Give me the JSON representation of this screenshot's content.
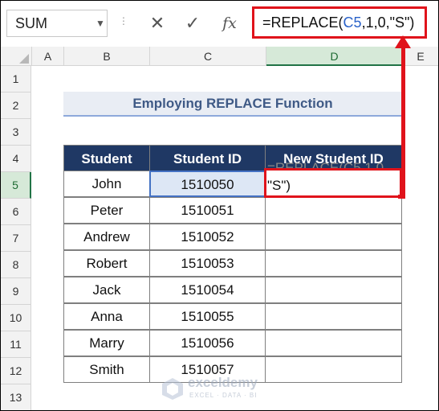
{
  "formula_bar": {
    "name_box": "SUM",
    "cancel_glyph": "✕",
    "enter_glyph": "✓",
    "fx_label": "fx",
    "formula_prefix": "=REPLACE(",
    "formula_ref": "C5",
    "formula_suffix": ",1,0,\"S\")"
  },
  "columns": [
    "A",
    "B",
    "C",
    "D",
    "E"
  ],
  "rows": [
    "1",
    "2",
    "3",
    "4",
    "5",
    "6",
    "7",
    "8",
    "9",
    "10",
    "11",
    "12",
    "13"
  ],
  "title": "Employing REPLACE Function",
  "table": {
    "headers": [
      "Student",
      "Student ID",
      "New Student ID"
    ],
    "rows": [
      {
        "student": "John",
        "id": "1510050"
      },
      {
        "student": "Peter",
        "id": "1510051"
      },
      {
        "student": "Andrew",
        "id": "1510052"
      },
      {
        "student": "Robert",
        "id": "1510053"
      },
      {
        "student": "Jack",
        "id": "1510054"
      },
      {
        "student": "Anna",
        "id": "1510055"
      },
      {
        "student": "Marry",
        "id": "1510056"
      },
      {
        "student": "Smith",
        "id": "1510057"
      }
    ]
  },
  "editing_cell": {
    "ghost_text": "=REPLACE(C5,1,0,",
    "visible_text": "\"S\")"
  },
  "watermark": {
    "name": "exceldemy",
    "tagline": "EXCEL · DATA · BI"
  },
  "colors": {
    "header_fill": "#1f3864",
    "highlight_red": "#e0131b",
    "selected_green": "#217346",
    "ref_blue": "#2a62c9"
  }
}
